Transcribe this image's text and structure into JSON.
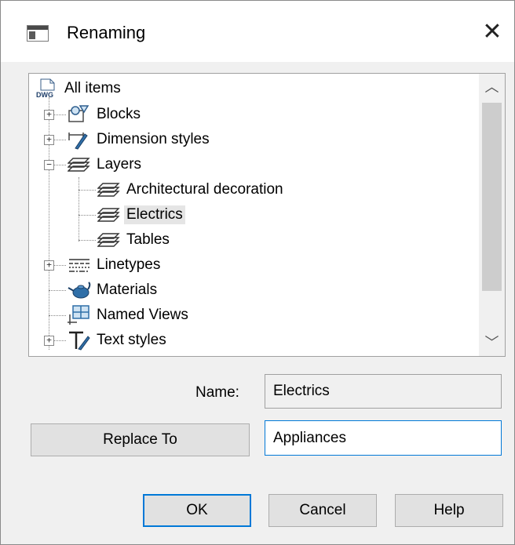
{
  "window": {
    "title": "Renaming",
    "app_icon": "dialog-window-icon",
    "close_glyph": "✕"
  },
  "tree": {
    "root": {
      "label": "All items",
      "icon": "dwg-file-icon",
      "icon_text": "DWG"
    },
    "items": [
      {
        "label": "Blocks",
        "icon": "blocks-icon",
        "expander": "+"
      },
      {
        "label": "Dimension styles",
        "icon": "dimension-styles-icon",
        "expander": "+"
      },
      {
        "label": "Layers",
        "icon": "layers-icon",
        "expander": "−"
      },
      {
        "label": "Architectural decoration",
        "icon": "layers-icon"
      },
      {
        "label": "Electrics",
        "icon": "layers-icon",
        "selected": true
      },
      {
        "label": "Tables",
        "icon": "layers-icon"
      },
      {
        "label": "Linetypes",
        "icon": "linetypes-icon",
        "expander": "+"
      },
      {
        "label": "Materials",
        "icon": "materials-icon"
      },
      {
        "label": "Named Views",
        "icon": "named-views-icon"
      },
      {
        "label": "Text styles",
        "icon": "text-styles-icon",
        "expander": "+"
      }
    ],
    "scroll_up_glyph": "︿",
    "scroll_down_glyph": "﹀"
  },
  "name": {
    "label": "Name:",
    "value": "Electrics"
  },
  "replace": {
    "button_label": "Replace To",
    "value": "Appliances"
  },
  "buttons": {
    "ok": "OK",
    "cancel": "Cancel",
    "help": "Help"
  }
}
